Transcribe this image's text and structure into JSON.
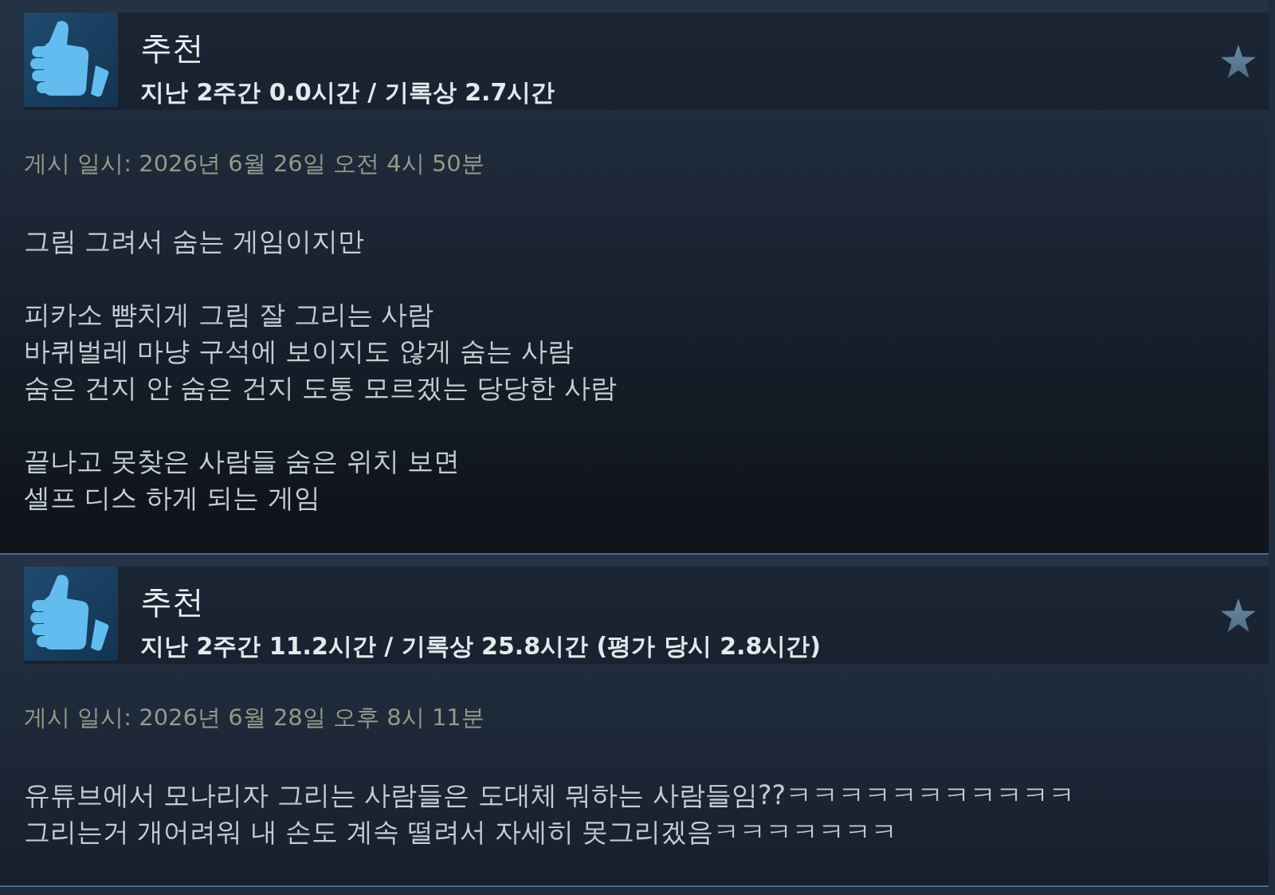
{
  "reviews": [
    {
      "verdict": "추천",
      "playtime": "지난 2주간 0.0시간 / 기록상 2.7시간",
      "posted": "게시 일시: 2026년 6월 26일 오전 4시 50분",
      "paragraphs": [
        "그림 그려서 숨는 게임이지만",
        "피카소 뺨치게 그림 잘 그리는 사람\n바퀴벌레 마냥 구석에 보이지도 않게 숨는 사람\n숨은 건지 안 숨은 건지 도통 모르겠는 당당한 사람",
        "끝나고 못찾은 사람들 숨은 위치 보면\n셀프 디스 하게 되는 게임"
      ]
    },
    {
      "verdict": "추천",
      "playtime": "지난 2주간 11.2시간 / 기록상 25.8시간 (평가 당시 2.8시간)",
      "posted": "게시 일시: 2026년 6월 28일 오후 8시 11분",
      "paragraphs": [
        "유튜브에서 모나리자 그리는 사람들은 도대체 뭐하는 사람들임??ㅋㅋㅋㅋㅋㅋㅋㅋㅋㅋㅋ\n그리는거 개어려워 내 손도 계속 떨려서 자세히 못그리겠음ㅋㅋㅋㅋㅋㅋㅋ"
      ]
    }
  ]
}
